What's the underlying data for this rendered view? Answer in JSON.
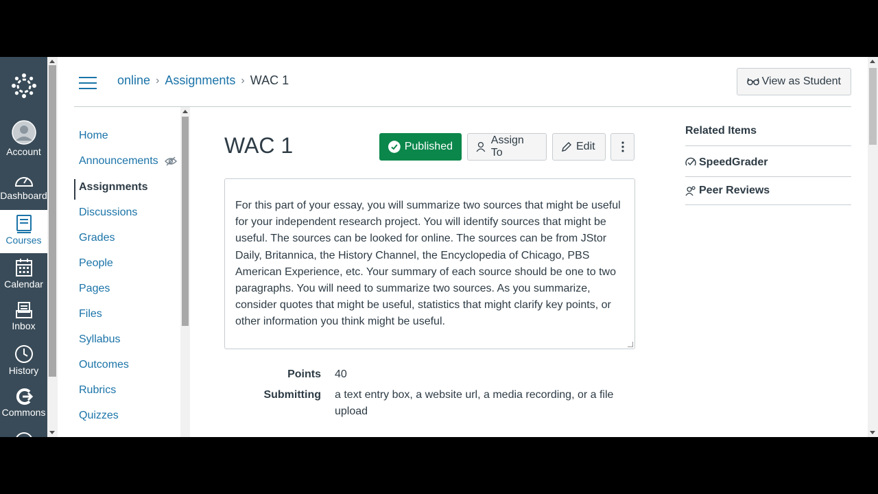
{
  "global_nav": {
    "items": [
      {
        "icon": "account-icon",
        "label": "Account"
      },
      {
        "icon": "dashboard-icon",
        "label": "Dashboard"
      },
      {
        "icon": "courses-icon",
        "label": "Courses",
        "active": true
      },
      {
        "icon": "calendar-icon",
        "label": "Calendar"
      },
      {
        "icon": "inbox-icon",
        "label": "Inbox"
      },
      {
        "icon": "history-icon",
        "label": "History"
      },
      {
        "icon": "commons-icon",
        "label": "Commons"
      }
    ]
  },
  "header": {
    "breadcrumbs": [
      "online",
      "Assignments",
      "WAC 1"
    ],
    "view_as_student_label": "View as Student"
  },
  "course_nav": {
    "items": [
      "Home",
      "Announcements",
      "Assignments",
      "Discussions",
      "Grades",
      "People",
      "Pages",
      "Files",
      "Syllabus",
      "Outcomes",
      "Rubrics",
      "Quizzes"
    ],
    "active": "Assignments"
  },
  "assignment": {
    "title": "WAC 1",
    "published_label": "Published",
    "assign_to_label": "Assign To",
    "edit_label": "Edit",
    "description": "For this part of your essay, you will summarize two sources that might be useful for your independent research project. You will identify sources that might be useful. The sources can be looked for online. The sources can be from JStor Daily, Britannica, the History Channel, the Encyclopedia of Chicago, PBS American Experience, etc. Your summary of each source should be one to two paragraphs. You will need to summarize two sources. As you summarize, consider quotes that might be useful, statistics that might clarify key points, or other information you think might be useful.",
    "points_label": "Points",
    "points_value": "40",
    "submitting_label": "Submitting",
    "submitting_value": "a text entry box, a website url, a media recording, or a file upload"
  },
  "related": {
    "heading": "Related Items",
    "speedgrader_label": "SpeedGrader",
    "peer_reviews_label": "Peer Reviews"
  },
  "colors": {
    "nav_bg": "#394b58",
    "link": "#1a73a8",
    "published_green": "#0b874b"
  }
}
